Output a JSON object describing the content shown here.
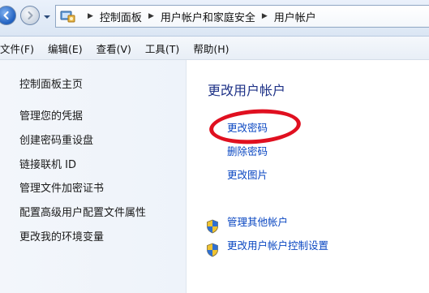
{
  "address_bar": {
    "breadcrumbs": [
      "控制面板",
      "用户帐户和家庭安全",
      "用户帐户"
    ]
  },
  "menu": [
    "文件(F)",
    "编辑(E)",
    "查看(V)",
    "工具(T)",
    "帮助(H)"
  ],
  "sidebar": {
    "home": "控制面板主页",
    "tasks": [
      "管理您的凭据",
      "创建密码重设盘",
      "链接联机 ID",
      "管理文件加密证书",
      "配置高级用户配置文件属性",
      "更改我的环境变量"
    ]
  },
  "main": {
    "title": "更改用户帐户",
    "links": [
      "更改密码",
      "删除密码",
      "更改图片"
    ],
    "shield_links": [
      "管理其他帐户",
      "更改用户帐户控制设置"
    ]
  },
  "colors": {
    "link": "#0a47c2",
    "title": "#1e3287",
    "highlight_circle": "#e01020"
  },
  "icons": {
    "back": "back-arrow-icon",
    "forward": "forward-arrow-icon",
    "control_panel": "control-panel-icon",
    "shield": "uac-shield-icon"
  }
}
